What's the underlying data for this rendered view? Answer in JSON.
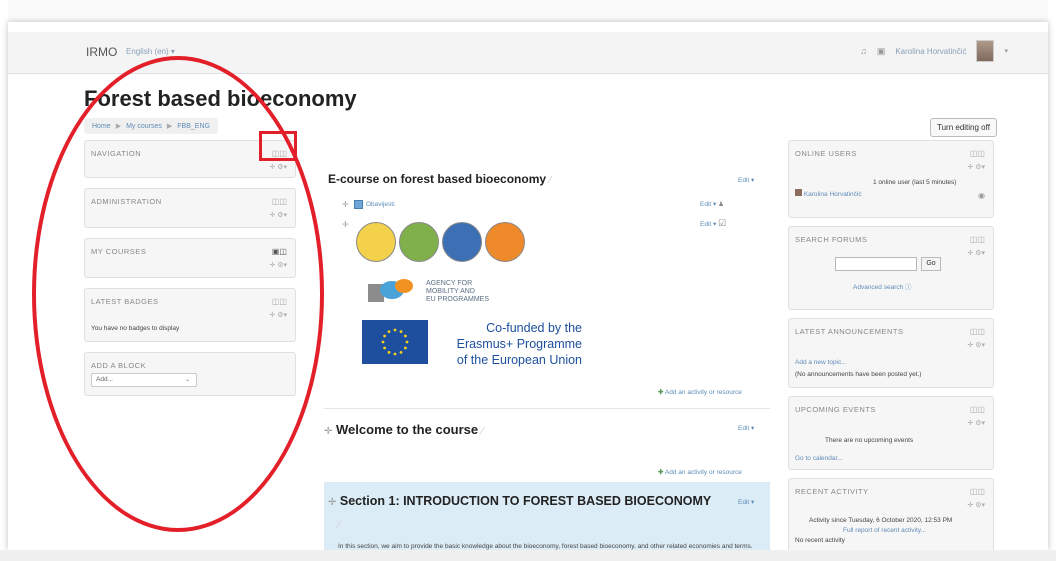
{
  "navbar": {
    "site_name": "IRMO",
    "language": "English (en) ▾",
    "user_name": "Karolina Horvatinčić",
    "user_caret": "▾"
  },
  "page": {
    "title": "Forest based bioeconomy",
    "breadcrumb": [
      "Home",
      "My courses",
      "FBB_ENG"
    ],
    "turn_editing": "Turn editing off"
  },
  "left_blocks": {
    "navigation": "NAVIGATION",
    "administration": "ADMINISTRATION",
    "my_courses": "MY COURSES",
    "latest_badges": "LATEST BADGES",
    "badges_empty": "You have no badges to display",
    "add_block": "ADD A BLOCK",
    "add_select": "Add..."
  },
  "course": {
    "section0_title": "E-course on forest based bioeconomy",
    "edit": "Edit ▾",
    "forum_link": "Obavijesti",
    "agency_lines": [
      "AGENCY FOR",
      "MOBILITY AND",
      "EU PROGRAMMES"
    ],
    "cofunded_lines": [
      "Co-funded by the",
      "Erasmus+ Programme",
      "of the European Union"
    ],
    "add_activity": "Add an activity or resource",
    "welcome_title": "Welcome to the course",
    "section1_title": "Section 1: INTRODUCTION TO FOREST BASED BIOECONOMY",
    "section1_text": "In this section, we aim to provide the basic knowledge about the bioeconomy, forest based bioeconomy, and other related economies and terms. Enjoy our introductory video about the forest based bioeconomy."
  },
  "right_blocks": {
    "online_users": "ONLINE USERS",
    "online_count": "1 online user (last 5 minutes)",
    "online_user": "Karolina Horvatinčić",
    "search_forums": "SEARCH FORUMS",
    "go": "Go",
    "advanced_search": "Advanced search ⓘ",
    "latest_announcements": "LATEST ANNOUNCEMENTS",
    "add_topic": "Add a new topic...",
    "no_announcements": "(No announcements have been posted yet.)",
    "upcoming_events": "UPCOMING EVENTS",
    "no_events": "There are no upcoming events",
    "go_calendar": "Go to calendar...",
    "recent_activity": "RECENT ACTIVITY",
    "activity_since": "Activity since Tuesday, 6 October 2020, 12:53 PM",
    "full_report": "Full report of recent activity...",
    "no_recent": "No recent activity"
  },
  "colors": {
    "annotation": "#e3202a",
    "link": "#5e8cb8",
    "section_highlight": "#dcecf6",
    "eu_blue": "#1d4f9e"
  }
}
